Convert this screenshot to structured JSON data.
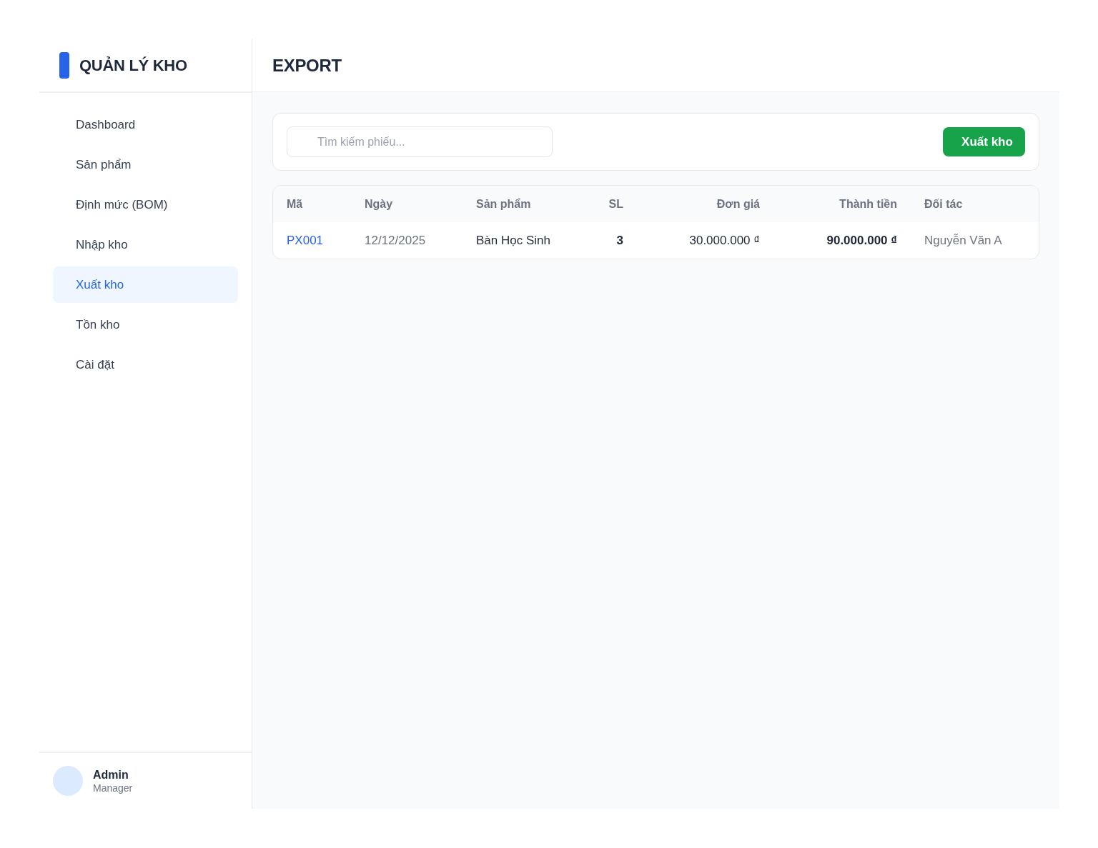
{
  "sidebar": {
    "brand": "QUẢN LÝ KHO",
    "items": [
      {
        "label": "Dashboard",
        "selected": false
      },
      {
        "label": "Sản phẩm",
        "selected": false
      },
      {
        "label": "Định mức (BOM)",
        "selected": false
      },
      {
        "label": "Nhập kho",
        "selected": false
      },
      {
        "label": "Xuất kho",
        "selected": true
      },
      {
        "label": "Tồn kho",
        "selected": false
      },
      {
        "label": "Cài đặt",
        "selected": false
      }
    ],
    "user": {
      "name": "Admin",
      "role": "Manager"
    }
  },
  "header": {
    "title": "EXPORT"
  },
  "toolbar": {
    "search": {
      "placeholder": "Tìm kiếm phiếu..."
    },
    "button": "Xuất kho"
  },
  "table": {
    "columns": [
      {
        "label": "Mã",
        "kind": "link"
      },
      {
        "label": "Ngày",
        "kind": "muted"
      },
      {
        "label": "Sản phẩm",
        "kind": "plain"
      },
      {
        "label": "SL",
        "kind": "count"
      },
      {
        "label": "Đơn giá",
        "kind": "amount"
      },
      {
        "label": "Thành tiền",
        "kind": "total"
      },
      {
        "label": "Đối tác",
        "kind": "muted"
      }
    ],
    "rows": [
      {
        "cells": [
          "PX001",
          "12/12/2025",
          "Bàn Học Sinh",
          "3",
          "30.000.000 ₫",
          "90.000.000 ₫",
          "Nguyễn Văn A"
        ]
      }
    ]
  }
}
